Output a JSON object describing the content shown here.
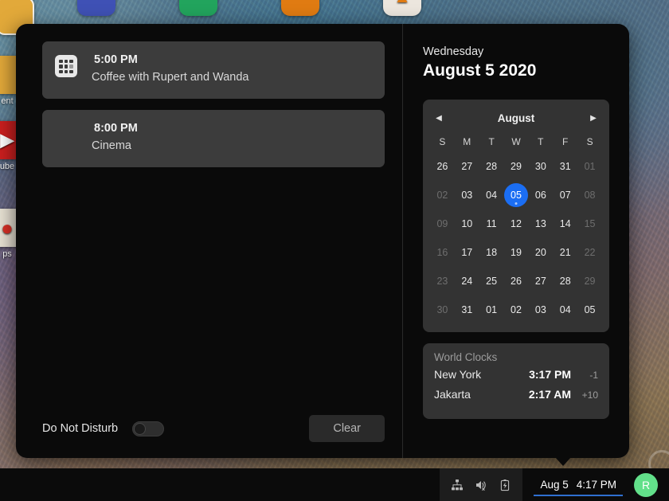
{
  "desktop": {
    "icons": [
      {
        "label": "",
        "color": "#e2a93a",
        "glyph": "",
        "name": "desktop-icon-documents-top"
      },
      {
        "label": "",
        "color": "#3f51b5",
        "glyph": "",
        "name": "desktop-icon-blue"
      },
      {
        "label": "",
        "color": "#22a45d",
        "glyph": "",
        "name": "desktop-icon-green"
      },
      {
        "label": "",
        "color": "#e07b12",
        "glyph": "",
        "name": "desktop-icon-orange"
      },
      {
        "label": "",
        "color": "#ece6de",
        "glyph": "",
        "name": "desktop-icon-white"
      },
      {
        "label": "ent",
        "color": "#e2a93a",
        "glyph": "",
        "name": "desktop-icon-documents"
      },
      {
        "label": "ube",
        "color": "#cc1f1f",
        "glyph": "▶",
        "name": "desktop-icon-youtube"
      },
      {
        "label": "ps",
        "color": "#e8e2d4",
        "glyph": "📍",
        "name": "desktop-icon-maps"
      }
    ]
  },
  "notifications": {
    "items": [
      {
        "time": "5:00 PM",
        "title": "Coffee with Rupert and Wanda",
        "icon": "calendar-grid-icon",
        "has_icon": true
      },
      {
        "time": "8:00 PM",
        "title": "Cinema",
        "icon": "",
        "has_icon": false
      }
    ],
    "dnd_label": "Do Not Disturb",
    "dnd_enabled": false,
    "clear_label": "Clear"
  },
  "calendar": {
    "weekday": "Wednesday",
    "full_date": "August 5 2020",
    "month": "August",
    "prev_icon": "◀",
    "next_icon": "▶",
    "day_headers": [
      "S",
      "M",
      "T",
      "W",
      "T",
      "F",
      "S"
    ],
    "today": "05",
    "accent_color": "#1b6ef3",
    "weeks": [
      [
        {
          "d": "26",
          "dim": false
        },
        {
          "d": "27",
          "dim": false
        },
        {
          "d": "28",
          "dim": false
        },
        {
          "d": "29",
          "dim": false
        },
        {
          "d": "30",
          "dim": false
        },
        {
          "d": "31",
          "dim": false
        },
        {
          "d": "01",
          "dim": true
        }
      ],
      [
        {
          "d": "02",
          "dim": true
        },
        {
          "d": "03",
          "dim": false
        },
        {
          "d": "04",
          "dim": false
        },
        {
          "d": "05",
          "dim": false,
          "today": true,
          "dot": true
        },
        {
          "d": "06",
          "dim": false
        },
        {
          "d": "07",
          "dim": false
        },
        {
          "d": "08",
          "dim": true
        }
      ],
      [
        {
          "d": "09",
          "dim": true
        },
        {
          "d": "10",
          "dim": false
        },
        {
          "d": "11",
          "dim": false
        },
        {
          "d": "12",
          "dim": false
        },
        {
          "d": "13",
          "dim": false
        },
        {
          "d": "14",
          "dim": false
        },
        {
          "d": "15",
          "dim": true
        }
      ],
      [
        {
          "d": "16",
          "dim": true
        },
        {
          "d": "17",
          "dim": false
        },
        {
          "d": "18",
          "dim": false
        },
        {
          "d": "19",
          "dim": false
        },
        {
          "d": "20",
          "dim": false
        },
        {
          "d": "21",
          "dim": false
        },
        {
          "d": "22",
          "dim": true
        }
      ],
      [
        {
          "d": "23",
          "dim": true
        },
        {
          "d": "24",
          "dim": false
        },
        {
          "d": "25",
          "dim": false
        },
        {
          "d": "26",
          "dim": false
        },
        {
          "d": "27",
          "dim": false
        },
        {
          "d": "28",
          "dim": false
        },
        {
          "d": "29",
          "dim": true
        }
      ],
      [
        {
          "d": "30",
          "dim": true
        },
        {
          "d": "31",
          "dim": false
        },
        {
          "d": "01",
          "dim": false
        },
        {
          "d": "02",
          "dim": false
        },
        {
          "d": "03",
          "dim": false
        },
        {
          "d": "04",
          "dim": false
        },
        {
          "d": "05",
          "dim": false
        }
      ]
    ]
  },
  "world_clocks": {
    "title": "World Clocks",
    "rows": [
      {
        "city": "New York",
        "time": "3:17 PM",
        "offset": "-1"
      },
      {
        "city": "Jakarta",
        "time": "2:17 AM",
        "offset": "+10"
      }
    ]
  },
  "taskbar": {
    "tray_icons": [
      "network-icon",
      "volume-muted-icon",
      "battery-charging-icon"
    ],
    "date": "Aug 5",
    "time": "4:17 PM",
    "avatar_initial": "R"
  }
}
